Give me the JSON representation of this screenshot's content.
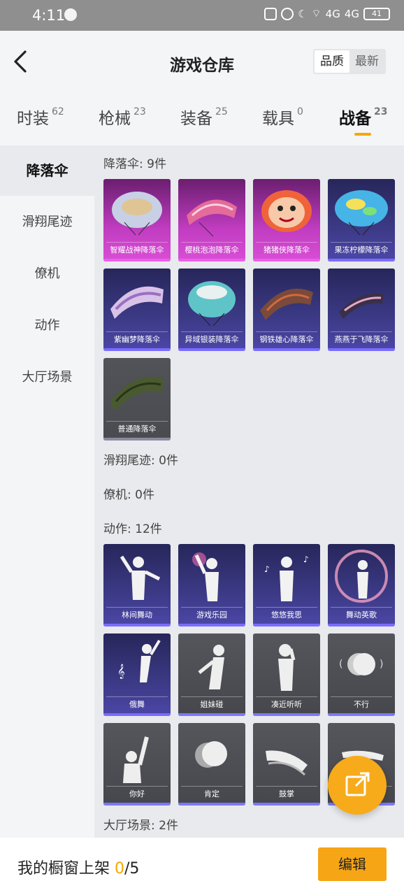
{
  "status_bar": {
    "time": "4:11",
    "battery": "41",
    "signal1": "4G",
    "signal2": "4G"
  },
  "header": {
    "title": "游戏仓库",
    "sort_options": [
      "品质",
      "最新"
    ],
    "sort_active": "品质"
  },
  "categories": [
    {
      "label": "时装",
      "count": "62"
    },
    {
      "label": "枪械",
      "count": "23"
    },
    {
      "label": "装备",
      "count": "25"
    },
    {
      "label": "载具",
      "count": "0"
    },
    {
      "label": "战备",
      "count": "23"
    }
  ],
  "active_category": "战备",
  "sidebar": [
    "降落伞",
    "滑翔尾迹",
    "僚机",
    "动作",
    "大厅场景"
  ],
  "sections": {
    "parachute": {
      "title": "降落伞: 9件",
      "items": [
        "智耀战神降落伞",
        "樱桃泡泡降落伞",
        "猪猪侠降落伞",
        "果冻柠檬降落伞",
        "紫幽梦降落伞",
        "异域银装降落伞",
        "钢铁雄心降落伞",
        "燕燕于飞降落伞",
        "普通降落伞"
      ]
    },
    "trail": {
      "title": "滑翔尾迹: 0件"
    },
    "wingman": {
      "title": "僚机: 0件"
    },
    "emote": {
      "title": "动作: 12件",
      "items": [
        "林间舞动",
        "游戏乐园",
        "悠悠我思",
        "舞动英歌",
        "俄舞",
        "姐妹碰",
        "凑近听听",
        "不行",
        "你好",
        "肯定",
        "鼓掌",
        ""
      ]
    },
    "lobby": {
      "title": "大厅场景: 2件"
    }
  },
  "footer": {
    "label": "我的橱窗上架",
    "count": "0",
    "total": "/5",
    "edit_label": "编辑"
  },
  "colors": {
    "accent": "#f5a800",
    "pink_quality": "#c03cc0",
    "purple_quality": "#3c3a86",
    "gray_quality": "#4a4b50"
  }
}
